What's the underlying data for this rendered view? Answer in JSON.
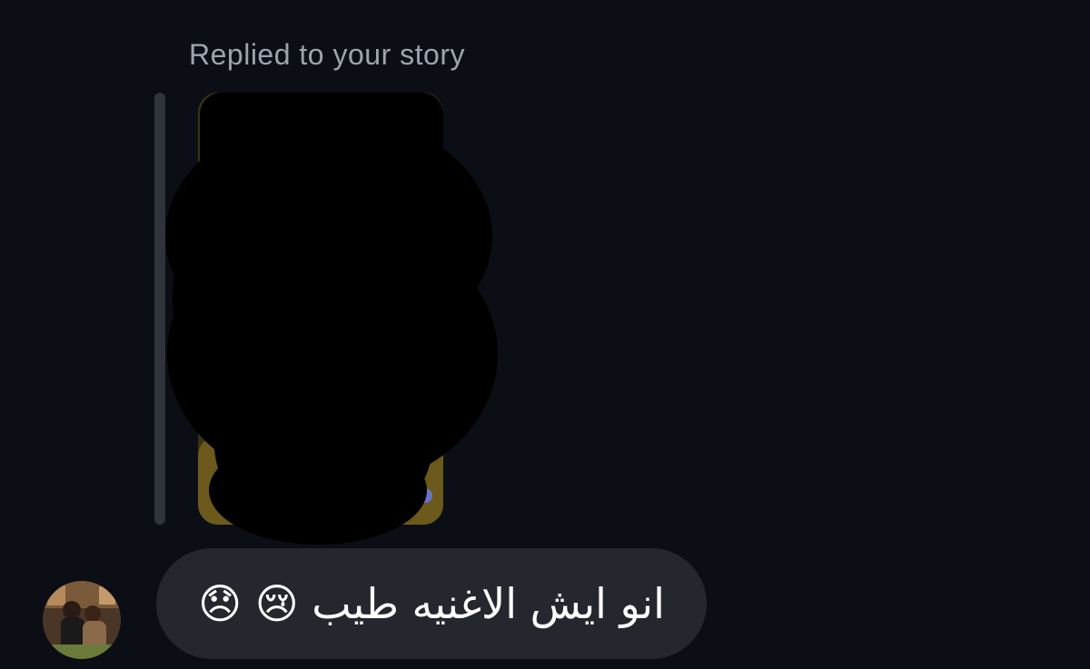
{
  "story_reply": {
    "caption": "Replied to your story"
  },
  "message": {
    "text": "انو ايش الاغنيه طيب 😢 😞",
    "direction": "rtl",
    "emojis": [
      "crying-face",
      "disappointed-face"
    ]
  },
  "sender": {
    "avatar": "profile-photo"
  },
  "colors": {
    "background": "#0b0e15",
    "bubble": "#24272e",
    "caption_text": "#9ea3ad",
    "message_text": "#ffffff",
    "quote_bar": "#2f333b"
  }
}
